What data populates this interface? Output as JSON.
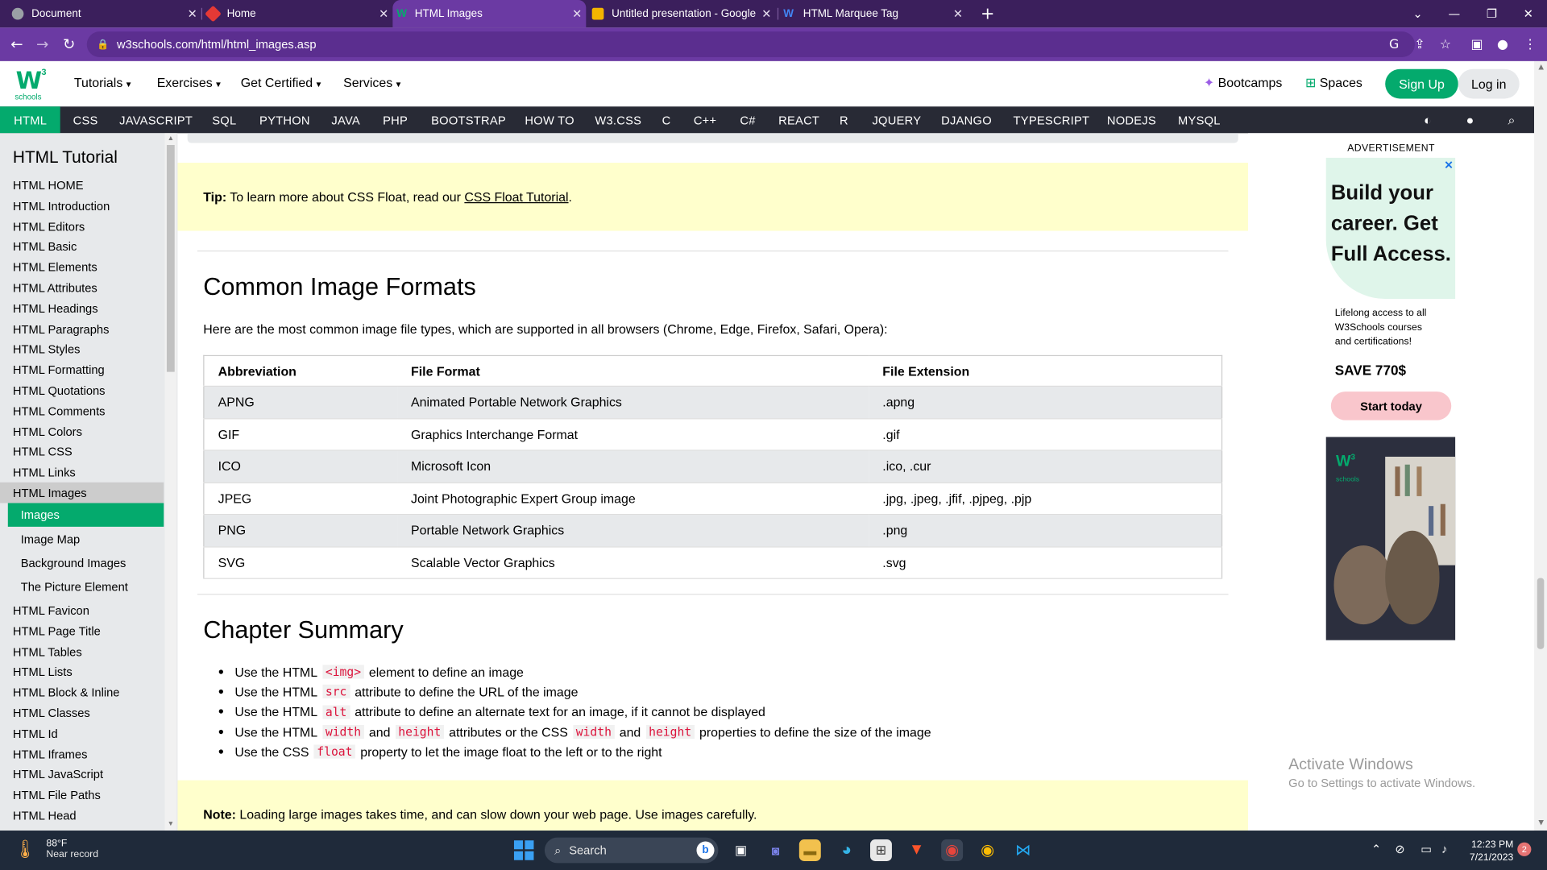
{
  "browser": {
    "tabs": [
      {
        "title": "Document",
        "favicon_color": "#9aa0a6"
      },
      {
        "title": "Home",
        "favicon_color": "#e53935"
      },
      {
        "title": "HTML Images",
        "favicon_color": "#04aa6d"
      },
      {
        "title": "Untitled presentation - Google Sl",
        "favicon_color": "#f4b400"
      },
      {
        "title": "HTML Marquee Tag",
        "favicon_color": "#4285f4"
      }
    ],
    "new_tab": "+",
    "url": "w3schools.com/html/html_images.asp"
  },
  "w3header": {
    "logo_text": "W",
    "logo_sup": "3",
    "logo_sub": "schools",
    "menus": [
      "Tutorials",
      "Exercises",
      "Get Certified",
      "Services"
    ],
    "bootcamps": "Bootcamps",
    "spaces": "Spaces",
    "signup": "Sign Up",
    "login": "Log in"
  },
  "topnav": [
    "HTML",
    "CSS",
    "JAVASCRIPT",
    "SQL",
    "PYTHON",
    "JAVA",
    "PHP",
    "BOOTSTRAP",
    "HOW TO",
    "W3.CSS",
    "C",
    "C++",
    "C#",
    "REACT",
    "R",
    "JQUERY",
    "DJANGO",
    "TYPESCRIPT",
    "NODEJS",
    "MYSQL"
  ],
  "sidebar": {
    "title": "HTML Tutorial",
    "items_top": [
      "HTML HOME",
      "HTML Introduction",
      "HTML Editors",
      "HTML Basic",
      "HTML Elements",
      "HTML Attributes",
      "HTML Headings",
      "HTML Paragraphs",
      "HTML Styles",
      "HTML Formatting",
      "HTML Quotations",
      "HTML Comments",
      "HTML Colors",
      "HTML CSS",
      "HTML Links",
      "HTML Images"
    ],
    "subitems": [
      "Images",
      "Image Map",
      "Background Images",
      "The Picture Element"
    ],
    "items_bottom": [
      "HTML Favicon",
      "HTML Page Title",
      "HTML Tables",
      "HTML Lists",
      "HTML Block & Inline",
      "HTML Classes",
      "HTML Id",
      "HTML Iframes",
      "HTML JavaScript",
      "HTML File Paths",
      "HTML Head"
    ]
  },
  "content": {
    "tip_label": "Tip:",
    "tip_text": " To learn more about CSS Float, read our ",
    "tip_link": "CSS Float Tutorial",
    "tip_end": ".",
    "heading1": "Common Image Formats",
    "intro": "Here are the most common image file types, which are supported in all browsers (Chrome, Edge, Firefox, Safari, Opera):",
    "table_headers": [
      "Abbreviation",
      "File Format",
      "File Extension"
    ],
    "table_rows": [
      [
        "APNG",
        "Animated Portable Network Graphics",
        ".apng"
      ],
      [
        "GIF",
        "Graphics Interchange Format",
        ".gif"
      ],
      [
        "ICO",
        "Microsoft Icon",
        ".ico, .cur"
      ],
      [
        "JPEG",
        "Joint Photographic Expert Group image",
        ".jpg, .jpeg, .jfif, .pjpeg, .pjp"
      ],
      [
        "PNG",
        "Portable Network Graphics",
        ".png"
      ],
      [
        "SVG",
        "Scalable Vector Graphics",
        ".svg"
      ]
    ],
    "heading2": "Chapter Summary",
    "summary": [
      {
        "a": "Use the HTML",
        "c1": "<img>",
        "b": "element to define an image"
      },
      {
        "a": "Use the HTML",
        "c1": "src",
        "b": "attribute to define the URL of the image"
      },
      {
        "a": "Use the HTML",
        "c1": "alt",
        "b": "attribute to define an alternate text for an image, if it cannot be displayed"
      },
      {
        "a": "Use the HTML",
        "c1": "width",
        "m": "and",
        "c2": "height",
        "n": "attributes or the CSS",
        "c3": "width",
        "o": "and",
        "c4": "height",
        "b": "properties to define the size of the image"
      },
      {
        "a": "Use the CSS",
        "c1": "float",
        "b": "property to let the image float to the left or to the right"
      }
    ],
    "note_label": "Note:",
    "note_text": " Loading large images takes time, and can slow down your web page. Use images carefully."
  },
  "ad": {
    "label": "ADVERTISEMENT",
    "headline": [
      "Build your",
      "career. Get",
      "Full Access."
    ],
    "close": "✕",
    "body": [
      "Lifelong access to all",
      "W3Schools courses",
      "and certifications!"
    ],
    "save": "SAVE 770$",
    "cta": "Start today",
    "logo": "W",
    "logo_sup": "3",
    "logo_sub": "schools"
  },
  "watermark": {
    "line1": "Activate Windows",
    "line2": "Go to Settings to activate Windows."
  },
  "taskbar": {
    "temp": "88°F",
    "weather": "Near record",
    "search": "Search",
    "time": "12:23 PM",
    "date": "7/21/2023",
    "notifications": "2"
  }
}
